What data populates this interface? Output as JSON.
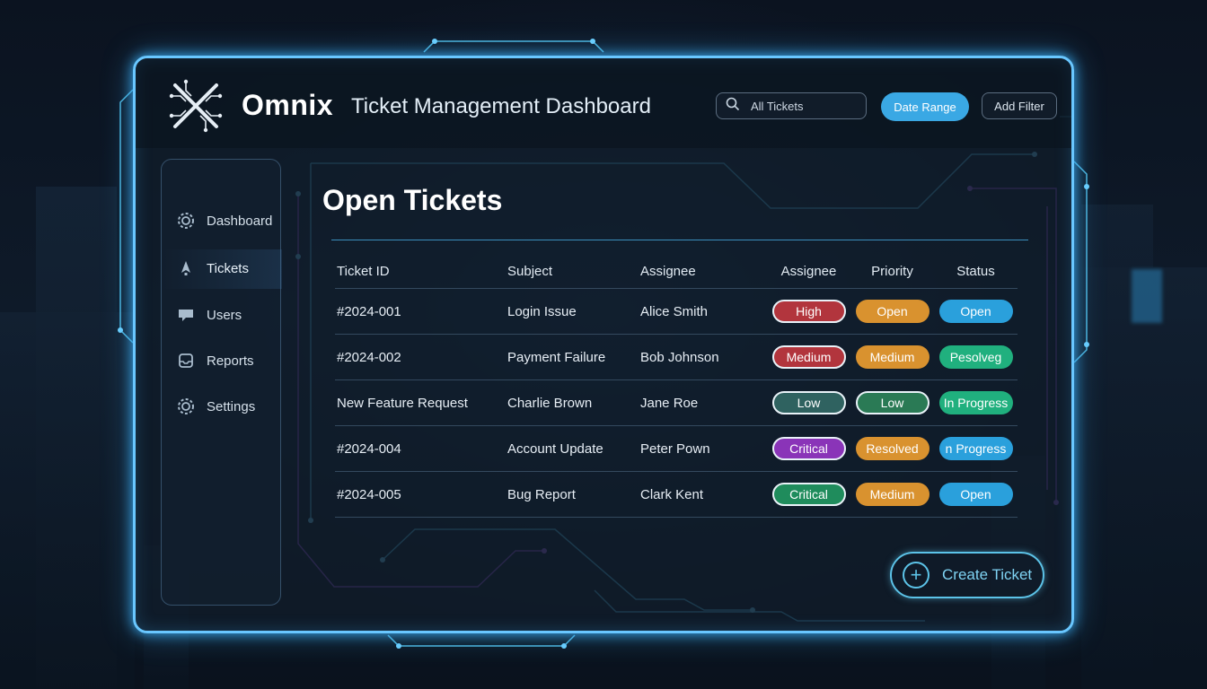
{
  "brand": {
    "name": "Omnix",
    "title": "Ticket Management Dashboard"
  },
  "toolbar": {
    "search_value": "All Tickets",
    "date_range_label": "Date Range",
    "add_filter_label": "Add Filter"
  },
  "sidebar": {
    "items": [
      {
        "label": "Dashboard",
        "icon": "gear-icon"
      },
      {
        "label": "Tickets",
        "icon": "rocket-icon"
      },
      {
        "label": "Users",
        "icon": "chat-icon"
      },
      {
        "label": "Reports",
        "icon": "inbox-icon"
      },
      {
        "label": "Settings",
        "icon": "gear-icon"
      }
    ]
  },
  "main": {
    "title": "Open Tickets",
    "columns": [
      "Ticket ID",
      "Subject",
      "Assignee",
      "Assignee",
      "Priority",
      "Status"
    ],
    "rows": [
      {
        "id": "#2024-001",
        "subject": "Login Issue",
        "assignee": "Alice Smith",
        "pill1": {
          "text": "High",
          "color": "#b2353d",
          "border": true
        },
        "pill2": {
          "text": "Open",
          "color": "#d9922f",
          "border": false
        },
        "pill3": {
          "text": "Open",
          "color": "#2aa0dc",
          "border": false
        }
      },
      {
        "id": "#2024-002",
        "subject": "Payment Failure",
        "assignee": "Bob Johnson",
        "pill1": {
          "text": "Medium",
          "color": "#b2353d",
          "border": true
        },
        "pill2": {
          "text": "Medium",
          "color": "#d9922f",
          "border": false
        },
        "pill3": {
          "text": "Pesolveg",
          "color": "#20b07e",
          "border": false
        }
      },
      {
        "id": "New Feature Request",
        "subject": "Charlie Brown",
        "assignee": "Jane Roe",
        "pill1": {
          "text": "Low",
          "color": "#2f6260",
          "border": true
        },
        "pill2": {
          "text": "Low",
          "color": "#2a7a55",
          "border": true
        },
        "pill3": {
          "text": "In Progress",
          "color": "#20b07e",
          "border": false
        }
      },
      {
        "id": "#2024-004",
        "subject": "Account Update",
        "assignee": "Peter Pown",
        "pill1": {
          "text": "Critical",
          "color": "#8a34b8",
          "border": true
        },
        "pill2": {
          "text": "Resolved",
          "color": "#d9922f",
          "border": false
        },
        "pill3": {
          "text": "n Progress",
          "color": "#2aa0dc",
          "border": false
        }
      },
      {
        "id": "#2024-005",
        "subject": "Bug Report",
        "assignee": "Clark Kent",
        "pill1": {
          "text": "Critical",
          "color": "#1f8c5c",
          "border": true
        },
        "pill2": {
          "text": "Medium",
          "color": "#d9922f",
          "border": false
        },
        "pill3": {
          "text": "Open",
          "color": "#2aa0dc",
          "border": false
        }
      }
    ]
  },
  "actions": {
    "create_label": "Create Ticket"
  },
  "colors": {
    "accent": "#69c7ff",
    "circuit_cyan": "#4fb8e0",
    "circuit_purple": "#8f4fd1"
  }
}
